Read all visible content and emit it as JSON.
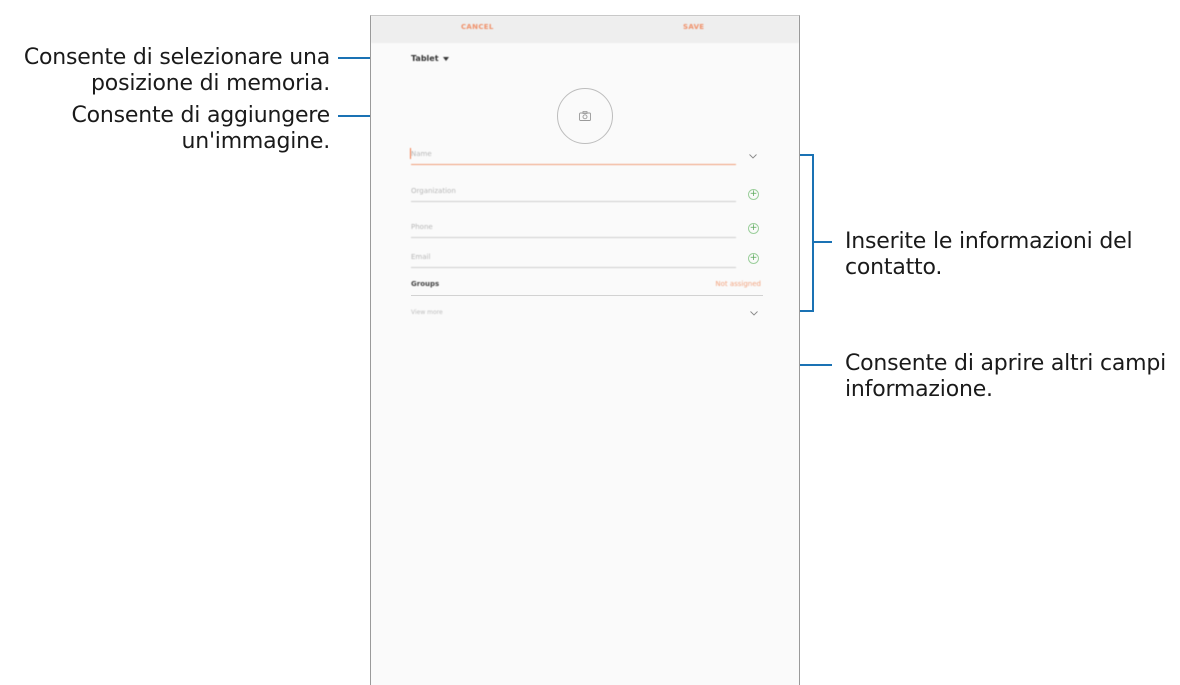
{
  "callouts": {
    "storage": {
      "lines": [
        "Consente di selezionare una",
        "posizione di memoria."
      ]
    },
    "image": {
      "lines": [
        "Consente di aggiungere",
        "un'immagine."
      ]
    },
    "contact": {
      "lines": [
        "Inserite le informazioni del",
        "contatto."
      ]
    },
    "more": {
      "lines": [
        "Consente di aprire altri campi",
        "informazione."
      ]
    }
  },
  "screen": {
    "topbar": {
      "cancel_label": "CANCEL",
      "save_label": "SAVE"
    },
    "storage_selector": {
      "label": "Tablet"
    },
    "photo": {
      "icon": "camera-icon"
    },
    "fields": {
      "name": {
        "placeholder": "Name",
        "icon": "chevron-down-icon"
      },
      "organization": {
        "placeholder": "Organization",
        "icon": "plus-icon"
      },
      "phone": {
        "placeholder": "Phone",
        "icon": "plus-icon"
      },
      "email": {
        "placeholder": "Email",
        "icon": "plus-icon"
      }
    },
    "groups": {
      "label": "Groups",
      "value": "Not assigned"
    },
    "view_more": {
      "label": "View more",
      "icon": "chevron-down-icon"
    }
  },
  "colors": {
    "accent": "#f0916a",
    "leader_line": "#1a72b4",
    "plus_green": "#5aa95a"
  }
}
